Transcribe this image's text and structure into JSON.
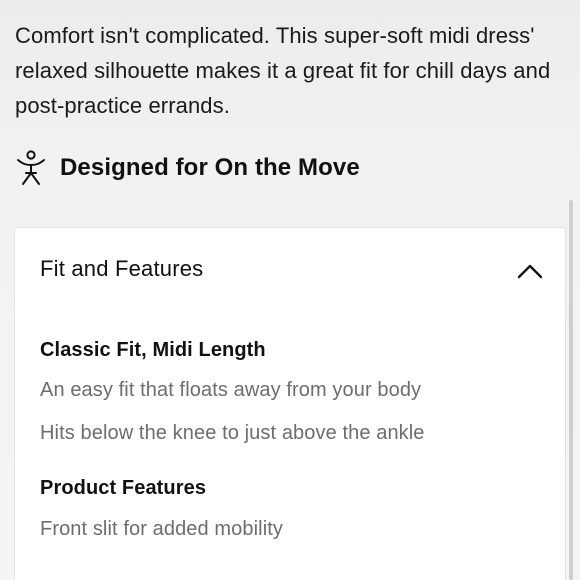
{
  "description": "Comfort isn't complicated. This super-soft midi dress' relaxed silhouette makes it a great fit for chill days and post-practice errands.",
  "designed_for": {
    "icon": "person-moving-icon",
    "label": "Designed for On the Move"
  },
  "fit_features": {
    "title": "Fit and Features",
    "toggle_icon": "chevron-up-icon",
    "expanded": true,
    "sections": [
      {
        "heading": "Classic Fit, Midi Length",
        "lines": [
          "An easy fit that floats away from your body",
          "Hits below the knee to just above the ankle"
        ]
      },
      {
        "heading": "Product Features",
        "lines": [
          "Front slit for added mobility"
        ]
      }
    ]
  }
}
